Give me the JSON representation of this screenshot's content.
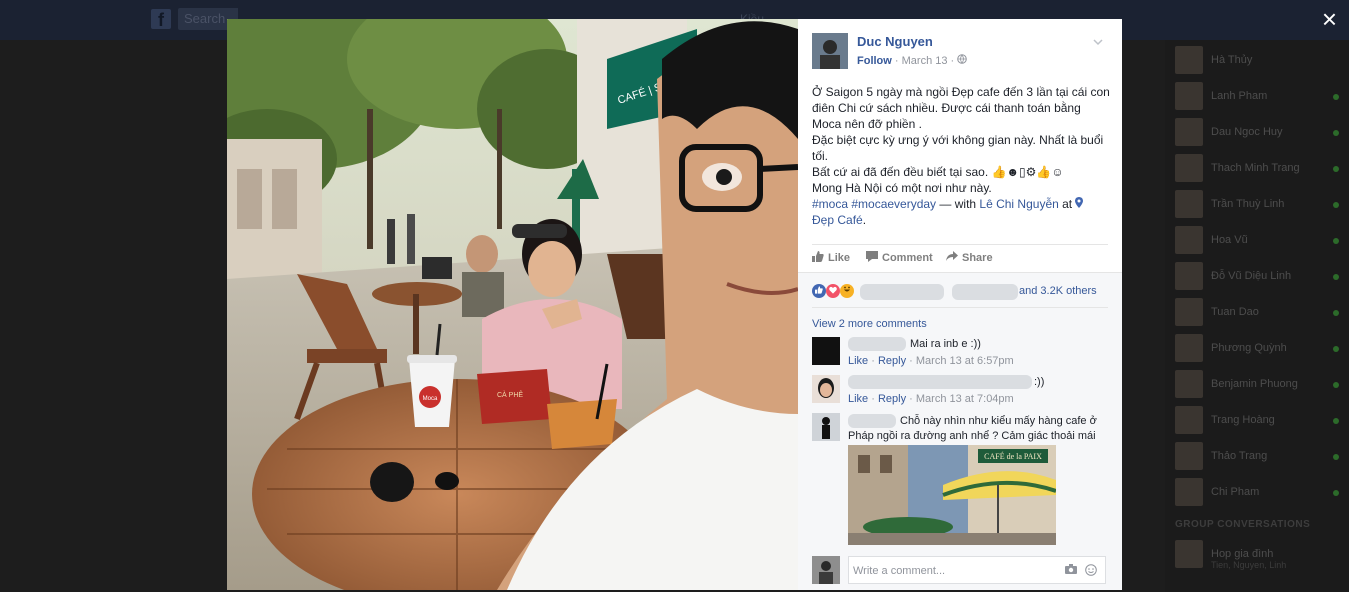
{
  "background": {
    "search_placeholder": "Search",
    "nav_text": "Kiều",
    "close_icon": "×",
    "chat_contacts": [
      "Hà Thủy",
      "Lanh Pham",
      "Dau Ngoc Huy",
      "Thach Minh Trang",
      "Trần Thuỳ Linh",
      "Hoa Vũ",
      "Đỗ Vũ Diệu Linh",
      "Tuan Dao",
      "Phương Quỳnh",
      "Benjamin Phuong",
      "Trang Hoàng",
      "Thảo Trang",
      "Chi Pham",
      "Hop gia đình"
    ],
    "chat_section_title": "GROUP CONVERSATIONS",
    "chat_group_sub": "Tien, Nguyen, Linh"
  },
  "post": {
    "author": "Duc Nguyen",
    "follow_label": "Follow",
    "date": "March 13",
    "privacy_icon": "globe-icon",
    "text_lines": [
      "Ở Saigon 5 ngày mà ngồi Đẹp cafe đến 3 lần tại cái con điên Chi cứ sách nhiều. Được cái thanh toán bằng Moca nên đỡ phiền .",
      "Đặc biệt cực kỳ ưng ý với không gian này. Nhất là buổi tối.",
      "Bất cứ ai đã đến đều biết tại sao. 👍☻▯⚙👍☺",
      "Mong Hà Nội có một nơi như này."
    ],
    "hashtags": "#moca #mocaeveryday",
    "with_label": " — with ",
    "tagged_person": "Lê Chi Nguyễn",
    "at_label": " at ",
    "location": "Đẹp Café",
    "location_suffix": "."
  },
  "actions": {
    "like": "Like",
    "comment": "Comment",
    "share": "Share"
  },
  "reactions": {
    "others": "and 3.2K others"
  },
  "comments": {
    "view_more": "View 2 more comments",
    "items": [
      {
        "text": "Mai ra inb e :))",
        "like": "Like",
        "reply": "Reply",
        "time": "March 13 at 6:57pm"
      },
      {
        "text": ":))",
        "like": "Like",
        "reply": "Reply",
        "time": "March 13 at 7:04pm"
      },
      {
        "text_line1": "Chỗ này nhìn như kiểu mấy hàng cafe ở",
        "text_line2": "Pháp ngồi ra đường anh nhể ? Cảm giác thoải mái",
        "attachment_sign": "CAFÉ de la PAIX"
      }
    ],
    "write_placeholder": "Write a comment..."
  },
  "photo": {
    "cup_label": "Moca",
    "book_label": "CÀ PHÊ",
    "awning_sign": "CAFÉ | SÁCH | T..."
  },
  "colors": {
    "link": "#365899",
    "overlay": "#1d1d1d",
    "like_blue": "#4267b2",
    "love_red": "#f25268",
    "haha_yellow": "#f7b125"
  }
}
